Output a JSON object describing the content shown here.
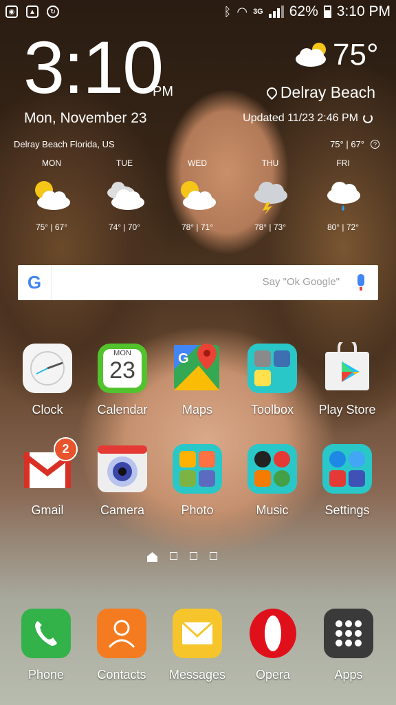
{
  "status_bar": {
    "battery": "62%",
    "time": "3:10 PM",
    "network": "3G",
    "left_icons": [
      "screenshot-icon",
      "gallery-icon",
      "sync-icon"
    ]
  },
  "clock_widget": {
    "time": "3:10",
    "ampm": "PM",
    "date": "Mon, November 23",
    "temperature": "75°",
    "location": "Delray Beach",
    "updated": "Updated  11/23  2:46 PM"
  },
  "weather": {
    "city": "Delray Beach Florida, US",
    "today_hilo": "75° | 67°",
    "forecast": [
      {
        "day": "MON",
        "range": "75° | 67°",
        "icon": "partly-sunny-icon"
      },
      {
        "day": "TUE",
        "range": "74° | 70°",
        "icon": "cloudy-icon"
      },
      {
        "day": "WED",
        "range": "78° | 71°",
        "icon": "partly-sunny-icon"
      },
      {
        "day": "THU",
        "range": "78° | 73°",
        "icon": "thunderstorm-icon"
      },
      {
        "day": "FRI",
        "range": "80° | 72°",
        "icon": "rain-icon"
      }
    ]
  },
  "search": {
    "placeholder": "Say \"Ok Google\"",
    "logo": "G"
  },
  "apps_row1": [
    {
      "label": "Clock"
    },
    {
      "label": "Calendar",
      "month": "MON",
      "day": "23"
    },
    {
      "label": "Maps"
    },
    {
      "label": "Toolbox"
    },
    {
      "label": "Play Store"
    }
  ],
  "apps_row2": [
    {
      "label": "Gmail",
      "badge": "2"
    },
    {
      "label": "Camera"
    },
    {
      "label": "Photo"
    },
    {
      "label": "Music"
    },
    {
      "label": "Settings"
    }
  ],
  "dock": [
    {
      "label": "Phone"
    },
    {
      "label": "Contacts"
    },
    {
      "label": "Messages"
    },
    {
      "label": "Opera"
    },
    {
      "label": "Apps"
    }
  ],
  "colors": {
    "folder": "#2ac7c9",
    "badge": "#e8542c",
    "google_blue": "#4285f4"
  }
}
